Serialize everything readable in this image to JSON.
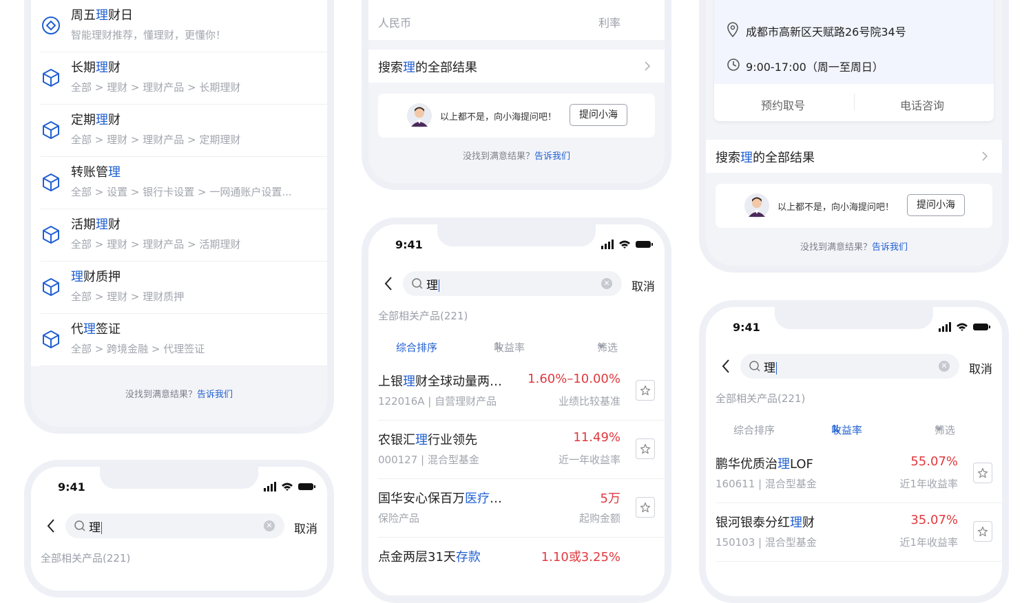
{
  "colors": {
    "highlight": "#1f5fd1",
    "rate_red": "#e0393e",
    "muted": "#9a9ea8",
    "frame": "#eef0f6"
  },
  "query": "理",
  "p1": {
    "list": [
      {
        "pre": "周五",
        "hl": "理",
        "post": "财日",
        "path": "智能理财推荐，懂理财，更懂你！",
        "icon": "diamond-icon"
      },
      {
        "pre": "长期",
        "hl": "理",
        "post": "财",
        "path": "全部 > 理财 > 理财产品 > 长期理财",
        "icon": "cube-icon"
      },
      {
        "pre": "定期",
        "hl": "理",
        "post": "财",
        "path": "全部 > 理财 > 理财产品 > 定期理财",
        "icon": "cube-icon"
      },
      {
        "pre": "转账管",
        "hl": "理",
        "post": "",
        "path": "全部 > 设置 > 银行卡设置 > 一网通账户设置...",
        "icon": "cube-icon"
      },
      {
        "pre": "活期",
        "hl": "理",
        "post": "财",
        "path": "全部 > 理财 > 理财产品 > 活期理财",
        "icon": "cube-icon"
      },
      {
        "pre": "",
        "hl": "理",
        "post": "财质押",
        "path": "全部 > 理财 > 理财质押",
        "icon": "cube-icon"
      },
      {
        "pre": "代",
        "hl": "理",
        "post": "签证",
        "path": "全部 > 跨境金融 > 代理签证",
        "icon": "cube-icon"
      }
    ],
    "feedback_q": "没找到满意结果？",
    "feedback_link": "告诉我们"
  },
  "p2": {
    "top_left": "人民币",
    "top_right": "利率",
    "allres_pre": "搜索",
    "allres_hl": "理",
    "allres_post": "的全部结果",
    "ask_text": "以上都不是，向小海提问吧！",
    "ask_btn": "提问小海",
    "feedback_q": "没找到满意结果？",
    "feedback_link": "告诉我们"
  },
  "p3": {
    "address": "成都市高新区天赋路26号院34号",
    "hours": "9:00-17:00（周一至周日）",
    "btn_left": "预约取号",
    "btn_right": "电话咨询",
    "allres_pre": "搜索",
    "allres_hl": "理",
    "allres_post": "的全部结果",
    "ask_text": "以上都不是，向小海提问吧！",
    "ask_btn": "提问小海",
    "feedback_q": "没找到满意结果？",
    "feedback_link": "告诉我们"
  },
  "status": {
    "time": "9:41"
  },
  "search": {
    "value": "理",
    "cancel": "取消",
    "count": "全部相关产品(221)"
  },
  "sort": {
    "comprehensive": "综合排序",
    "yield": "收益率",
    "filter": "筛选"
  },
  "p4_products": [
    {
      "pre": "上银",
      "hl": "理",
      "post": "财全球动量两…",
      "code": "122016A | 自营理财产品",
      "rate": "1.60%–10.00%",
      "rate_label": "业绩比较基准"
    },
    {
      "pre": "农银汇",
      "hl": "理",
      "post": "行业领先",
      "code": "000127 | 混合型基金",
      "rate": "11.49%",
      "rate_label": "近一年收益率"
    },
    {
      "pre": "国华安心保百万",
      "hl": "医疗",
      "post": "…",
      "code": "保险产品",
      "rate": "5万",
      "rate_label": "起购金额"
    },
    {
      "pre": "点金两层31天",
      "hl": "存款",
      "post": "",
      "code": "",
      "rate": "1.10或3.25%",
      "rate_label": ""
    }
  ],
  "p6_products": [
    {
      "pre": "鹏华优质治",
      "hl": "理",
      "post": "LOF",
      "code": "160611 | 混合型基金",
      "rate": "55.07%",
      "rate_label": "近1年收益率"
    },
    {
      "pre": "银河银泰分红",
      "hl": "理",
      "post": "财",
      "code": "150103 | 混合型基金",
      "rate": "35.07%",
      "rate_label": "近1年收益率"
    }
  ]
}
